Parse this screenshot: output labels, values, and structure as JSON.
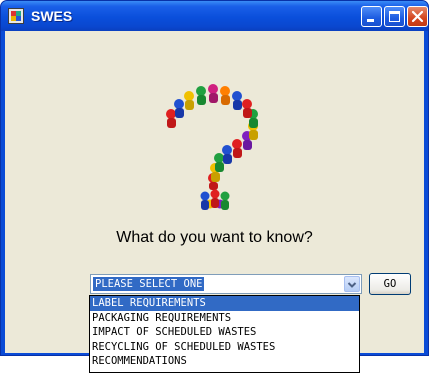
{
  "window": {
    "title": "SWES",
    "app_icon": "swes-app-icon"
  },
  "titlebar_buttons": {
    "minimize_icon": "minimize-icon",
    "maximize_icon": "maximize-icon",
    "close_icon": "close-icon"
  },
  "main": {
    "image": "crowd-question-mark-illustration",
    "prompt": "What do you want to know?",
    "topic_select": {
      "value": "PLEASE SELECT ONE",
      "arrow_icon": "chevron-down-icon"
    },
    "go_label": "GO"
  },
  "dropdown": {
    "options": [
      "LABEL REQUIREMENTS",
      "PACKAGING REQUIREMENTS",
      "IMPACT OF SCHEDULED WASTES",
      "RECYCLING OF SCHEDULED WASTES",
      "RECOMMENDATIONS"
    ],
    "highlighted_index": 0
  },
  "colors": {
    "titlebar": "#0a4fdb",
    "client_bg": "#ece9d8",
    "selection": "#316ac5"
  }
}
